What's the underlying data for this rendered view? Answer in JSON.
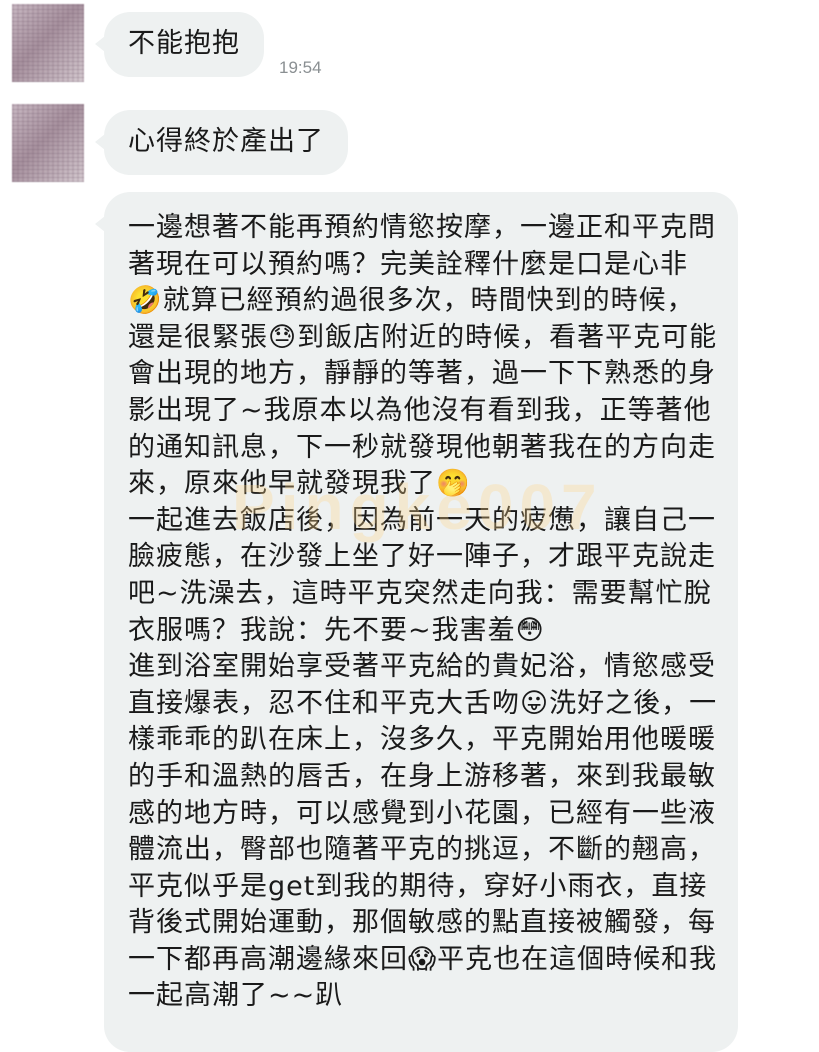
{
  "messages": [
    {
      "text": "不能抱抱",
      "time": "19:54"
    },
    {
      "text": "心得終於產出了"
    },
    {
      "text": "一邊想著不能再預約情慾按摩，一邊正和平克問著現在可以預約嗎？完美詮釋什麼是口是心非🤣就算已經預約過很多次，時間快到的時候，還是很緊張😓到飯店附近的時候，看著平克可能會出現的地方，靜靜的等著，過一下下熟悉的身影出現了~我原本以為他沒有看到我，正等著他的通知訊息，下一秒就發現他朝著我在的方向走來，原來他早就發現我了🤭\n一起進去飯店後，因為前一天的疲憊，讓自己一臉疲態，在沙發上坐了好一陣子，才跟平克說走吧~洗澡去，這時平克突然走向我：需要幫忙脫衣服嗎？我說：先不要~我害羞😳\n進到浴室開始享受著平克給的貴妃浴，情慾感受直接爆表，忍不住和平克大舌吻😛洗好之後，一樣乖乖的趴在床上，沒多久，平克開始用他暖暖的手和溫熱的唇舌，在身上游移著，來到我最敏感的地方時，可以感覺到小花園，已經有一些液體流出，臀部也隨著平克的挑逗，不斷的翹高，平克似乎是get到我的期待，穿好小雨衣，直接背後式開始運動，那個敏感的點直接被觸發，每一下都再高潮邊緣來回😱平克也在這個時候和我一起高潮了~~趴"
    }
  ],
  "watermark": "Pingke007",
  "colors": {
    "background": "#ffffff",
    "bubble": "#eef1f1",
    "timestamp": "#8a8f92"
  }
}
